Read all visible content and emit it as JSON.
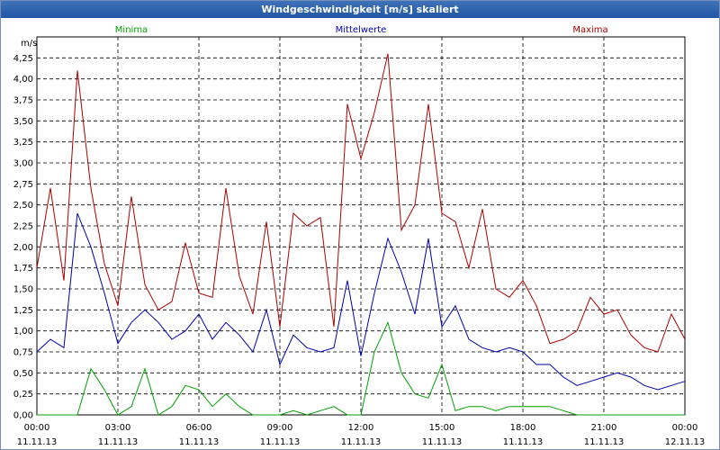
{
  "window": {
    "title": "Windgeschwindigkeit [m/s] skaliert"
  },
  "chart_data": {
    "type": "line",
    "title": "Windgeschwindigkeit [m/s] skaliert",
    "ylabel": "m/s",
    "xlabel": "",
    "ylim": [
      0,
      4.5
    ],
    "xlim_hours": [
      0,
      24
    ],
    "grid": true,
    "legend_placement": "top",
    "y_ticks": [
      "0,00",
      "0,25",
      "0,50",
      "0,75",
      "1,00",
      "1,25",
      "1,50",
      "1,75",
      "2,00",
      "2,25",
      "2,50",
      "2,75",
      "3,00",
      "3,25",
      "3,50",
      "3,75",
      "4,00",
      "4,25"
    ],
    "x_ticks": [
      {
        "time": "00:00",
        "date": "11.11.13"
      },
      {
        "time": "03:00",
        "date": "11.11.13"
      },
      {
        "time": "06:00",
        "date": "11.11.13"
      },
      {
        "time": "09:00",
        "date": "11.11.13"
      },
      {
        "time": "12:00",
        "date": "11.11.13"
      },
      {
        "time": "15:00",
        "date": "11.11.13"
      },
      {
        "time": "18:00",
        "date": "11.11.13"
      },
      {
        "time": "21:00",
        "date": "11.11.13"
      },
      {
        "time": "00:00",
        "date": "12.11.13"
      }
    ],
    "x": [
      0.0,
      0.5,
      1.0,
      1.5,
      2.0,
      2.5,
      3.0,
      3.5,
      4.0,
      4.5,
      5.0,
      5.5,
      6.0,
      6.5,
      7.0,
      7.5,
      8.0,
      8.5,
      9.0,
      9.5,
      10.0,
      10.5,
      11.0,
      11.5,
      12.0,
      12.5,
      13.0,
      13.5,
      14.0,
      14.5,
      15.0,
      15.5,
      16.0,
      16.5,
      17.0,
      17.5,
      18.0,
      18.5,
      19.0,
      19.5,
      20.0,
      20.5,
      21.0,
      21.5,
      22.0,
      22.5,
      23.0,
      23.5,
      24.0
    ],
    "series": [
      {
        "name": "Minima",
        "color": "#00a000",
        "values": [
          0.0,
          0.0,
          0.0,
          0.0,
          0.55,
          0.3,
          0.0,
          0.1,
          0.55,
          0.0,
          0.1,
          0.35,
          0.3,
          0.1,
          0.25,
          0.1,
          0.0,
          0.0,
          0.0,
          0.05,
          0.0,
          0.05,
          0.1,
          0.0,
          0.0,
          0.75,
          1.1,
          0.5,
          0.25,
          0.2,
          0.6,
          0.05,
          0.1,
          0.1,
          0.05,
          0.1,
          0.1,
          0.1,
          0.1,
          0.05,
          0.0,
          0.0,
          0.0,
          0.0,
          0.0,
          0.0,
          0.0,
          0.0,
          0.0
        ]
      },
      {
        "name": "Mittelwerte",
        "color": "#0000aa",
        "values": [
          0.75,
          0.9,
          0.8,
          2.4,
          2.0,
          1.45,
          0.85,
          1.1,
          1.25,
          1.1,
          0.9,
          1.0,
          1.2,
          0.9,
          1.1,
          0.95,
          0.75,
          1.25,
          0.6,
          0.95,
          0.8,
          0.75,
          0.8,
          1.6,
          0.7,
          1.45,
          2.1,
          1.7,
          1.2,
          2.1,
          1.05,
          1.3,
          0.9,
          0.8,
          0.75,
          0.8,
          0.75,
          0.6,
          0.6,
          0.45,
          0.35,
          0.4,
          0.45,
          0.5,
          0.45,
          0.35,
          0.3,
          0.35,
          0.4
        ]
      },
      {
        "name": "Maxima",
        "color": "#aa0000",
        "values": [
          1.75,
          2.7,
          1.6,
          4.1,
          2.7,
          1.8,
          1.3,
          2.6,
          1.55,
          1.25,
          1.35,
          2.05,
          1.45,
          1.4,
          2.7,
          1.65,
          1.2,
          2.3,
          1.05,
          2.4,
          2.25,
          2.35,
          1.05,
          3.7,
          3.05,
          3.6,
          4.3,
          2.2,
          2.5,
          3.7,
          2.4,
          2.3,
          1.75,
          2.45,
          1.5,
          1.4,
          1.6,
          1.3,
          0.85,
          0.9,
          1.0,
          1.4,
          1.2,
          1.25,
          0.95,
          0.8,
          0.75,
          1.2,
          0.9
        ]
      }
    ]
  }
}
